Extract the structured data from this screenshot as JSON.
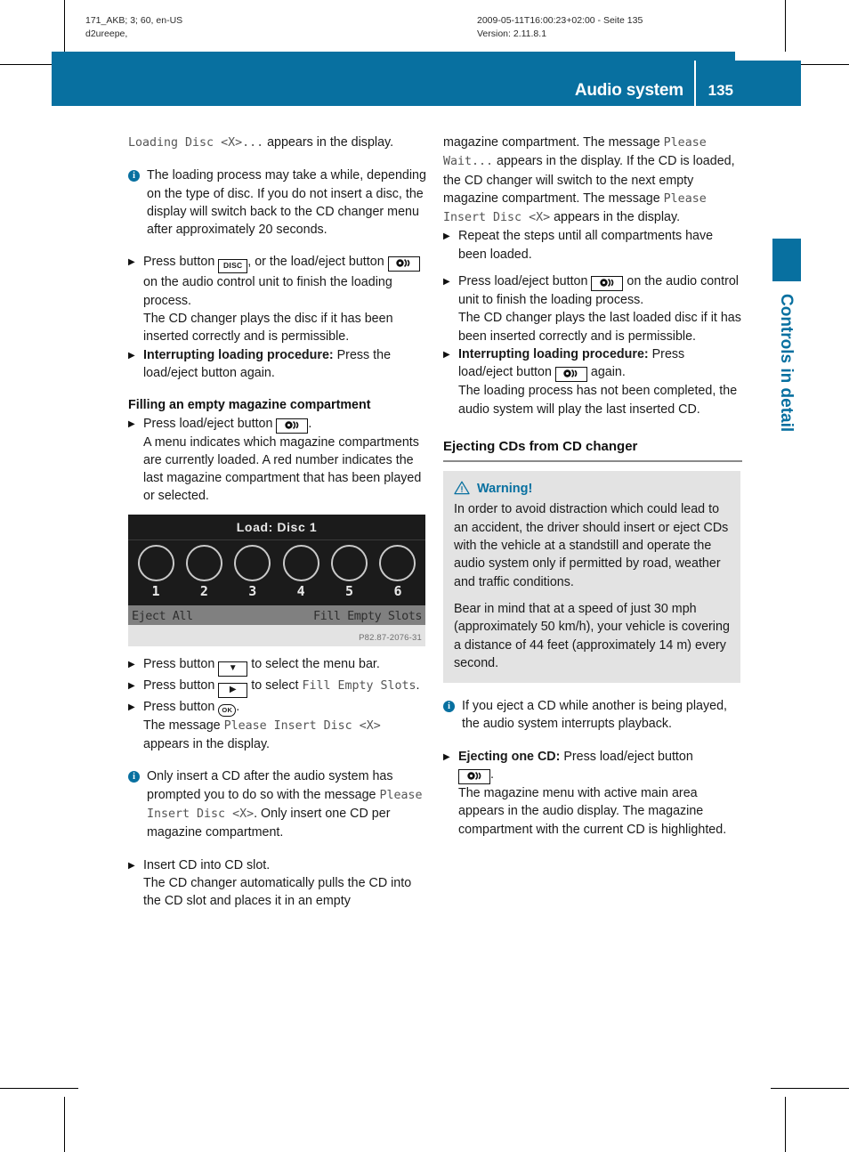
{
  "print_meta": {
    "left_line1": "171_AKB; 3; 60, en-US",
    "left_line2": "d2ureepe,",
    "right_line1": "2009-05-11T16:00:23+02:00 - Seite 135",
    "right_line2": "Version: 2.11.8.1"
  },
  "header": {
    "title": "Audio system",
    "page_number": "135",
    "accent_color": "#0870a0"
  },
  "thumb_tab": {
    "label": "Controls in detail"
  },
  "keys": {
    "disc": "DISC",
    "ok": "OK"
  },
  "left_column": {
    "intro": {
      "message": "Loading Disc <X>...",
      "after": " appears in the display."
    },
    "note_loading": "The loading process may take a while, depending on the type of disc. If you do not insert a disc, the display will switch back to the CD changer menu after approximately 20 seconds.",
    "step_press_disc": {
      "prefix": "Press button ",
      "middle": ", or the load/eject button ",
      "suffix": " on the audio control unit to finish the loading process.",
      "sub": "The CD changer plays the disc if it has been inserted correctly and is permissible."
    },
    "step_interrupt": {
      "bold": "Interrupting loading procedure:",
      "rest": " Press the load/eject button again."
    },
    "heading_filling": "Filling an empty magazine compartment",
    "step_press_eject": {
      "prefix": "Press load/eject button ",
      "suffix": ".",
      "sub": "A menu indicates which magazine compartments are currently loaded. A red number indicates the last magazine compartment that has been played or selected."
    },
    "figure": {
      "title": "Load: Disc 1",
      "slots": [
        "1",
        "2",
        "3",
        "4",
        "5",
        "6"
      ],
      "menu_left": "Eject All",
      "menu_right": "Fill Empty Slots",
      "caption": "P82.87-2076-31"
    },
    "step_menu_bar": {
      "prefix": "Press button ",
      "suffix": " to select the menu bar."
    },
    "step_fill_empty": {
      "prefix": "Press button ",
      "middle": " to select ",
      "mono": "Fill Empty Slots",
      "suffix": "."
    },
    "step_press_ok": {
      "prefix": "Press button ",
      "suffix": ".",
      "sub_prefix": "The message ",
      "sub_mono": "Please Insert Disc <X>",
      "sub_suffix": " appears in the display."
    },
    "note_only_insert": {
      "part1": "Only insert a CD after the audio system has prompted you to do so with the message ",
      "mono": "Please Insert Disc <X>",
      "part2": ". Only insert one CD per magazine compartment."
    },
    "step_insert_cd": {
      "main": "Insert CD into CD slot.",
      "sub": "The CD changer automatically pulls the CD into the CD slot and places it in an empty"
    }
  },
  "right_column": {
    "continuation": {
      "part1": "magazine compartment. The message ",
      "mono1": "Please Wait...",
      "part2": " appears in the display. If the CD is loaded, the CD changer will switch to the next empty magazine compartment. The message ",
      "mono2": "Please Insert Disc <X>",
      "part3": " appears in the display."
    },
    "step_repeat": "Repeat the steps until all compartments have been loaded.",
    "step_press_eject_finish": {
      "prefix": "Press load/eject button ",
      "suffix": " on the audio control unit to finish the loading process.",
      "sub": "The CD changer plays the last loaded disc if it has been inserted correctly and is permissible."
    },
    "step_interrupt": {
      "bold": "Interrupting loading procedure:",
      "mid": " Press load/eject button ",
      "rest": " again.",
      "sub": "The loading process has not been completed, the audio system will play the last inserted CD."
    },
    "heading_ejecting": "Ejecting CDs from CD changer",
    "warning": {
      "title": "Warning!",
      "paragraph1": "In order to avoid distraction which could lead to an accident, the driver should insert or eject CDs with the vehicle at a standstill and operate the audio system only if permitted by road, weather and traffic conditions.",
      "paragraph2": "Bear in mind that at a speed of just 30 mph (approximately 50 km/h), your vehicle is covering a distance of 44 feet (approximately 14 m) every second."
    },
    "note_eject": "If you eject a CD while another is being played, the audio system interrupts playback.",
    "step_eject_one": {
      "bold": "Ejecting one CD:",
      "rest": " Press load/eject button ",
      "suffix": ".",
      "sub": "The magazine menu with active main area appears in the audio display. The magazine compartment with the current CD is highlighted."
    }
  }
}
